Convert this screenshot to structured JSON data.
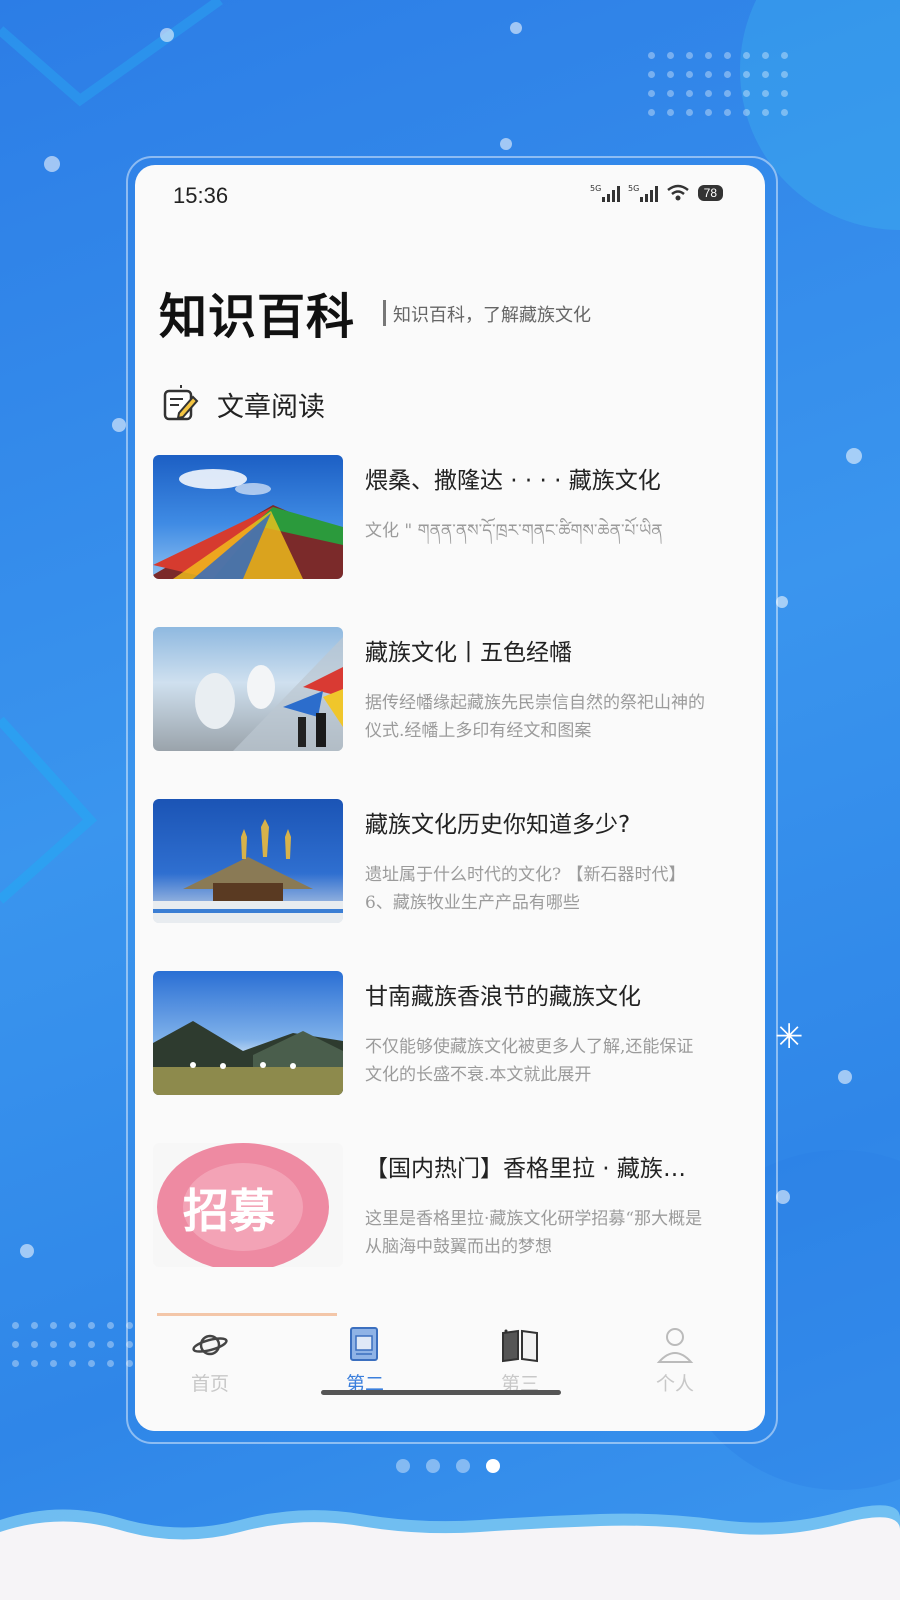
{
  "status_bar": {
    "time": "15:36",
    "signal1": "5G",
    "signal2": "5G",
    "battery": "78"
  },
  "header": {
    "title": "知识百科",
    "subtitle": "知识百科，了解藏族文化"
  },
  "section": {
    "icon": "edit-note-icon",
    "title": "文章阅读"
  },
  "articles": [
    {
      "title": "煨桑、撒隆达 · · · · 藏族文化",
      "desc": "文化 \" གནན་ནས་དོ་ཁྲར་གནང་ཚིགས་ཆེན་པོ་ཡིན",
      "image": "prayer-flags-sky"
    },
    {
      "title": "藏族文化丨五色经幡",
      "desc": "据传经幡缘起藏族先民崇信自然的祭祀山神的仪式.经幡上多印有经文和图案",
      "image": "mist-mountains-flags"
    },
    {
      "title": "藏族文化历史你知道多少?",
      "desc": "遗址属于什么时代的文化? 【新石器时代】6、藏族牧业生产产品有哪些",
      "image": "temple-roof"
    },
    {
      "title": "甘南藏族香浪节的藏族文化",
      "desc": "不仅能够使藏族文化被更多人了解,还能保证文化的长盛不衰.本文就此展开",
      "image": "grassland-mountains"
    },
    {
      "title": "【国内热门】香格里拉 · 藏族文化研学",
      "desc": "这里是香格里拉·藏族文化研学招募“那大概是从脑海中鼓翼而出的梦想",
      "image": "recruit-poster",
      "image_text": "招募"
    }
  ],
  "tabs": [
    {
      "label": "首页",
      "icon": "planet-icon",
      "active": false
    },
    {
      "label": "第二",
      "icon": "book-doc-icon",
      "active": true
    },
    {
      "label": "第三",
      "icon": "open-book-icon",
      "active": false
    },
    {
      "label": "个人",
      "icon": "person-icon",
      "active": false
    }
  ],
  "pager": {
    "count": 4,
    "active_index": 3
  },
  "colors": {
    "background": "#2f86e8",
    "accent": "#3b7fdc",
    "tab_inactive": "#c8c8c8"
  }
}
